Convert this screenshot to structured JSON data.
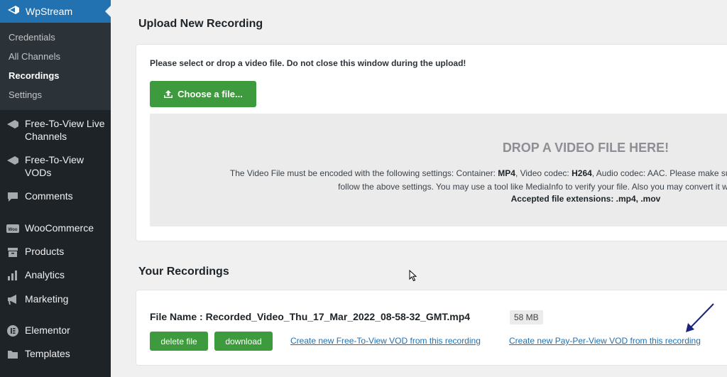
{
  "sidebar": {
    "app": "WpStream",
    "submenu": [
      "Credentials",
      "All Channels",
      "Recordings",
      "Settings"
    ],
    "active_sub": "Recordings",
    "items": [
      {
        "label": "Free-To-View Live Channels",
        "icon": "video-icon"
      },
      {
        "label": "Free-To-View VODs",
        "icon": "video-icon"
      },
      {
        "label": "Comments",
        "icon": "comment-icon"
      },
      {
        "label": "WooCommerce",
        "icon": "woo-icon"
      },
      {
        "label": "Products",
        "icon": "archive-icon"
      },
      {
        "label": "Analytics",
        "icon": "bar-chart-icon"
      },
      {
        "label": "Marketing",
        "icon": "megaphone-icon"
      },
      {
        "label": "Elementor",
        "icon": "elementor-icon"
      },
      {
        "label": "Templates",
        "icon": "folder-icon"
      }
    ]
  },
  "upload": {
    "heading": "Upload New Recording",
    "note": "Please select or drop a video file. Do not close this window during the upload!",
    "choose_label": "Choose a file...",
    "drop_title": "DROP A VIDEO FILE HERE!",
    "info1_pre": "The Video File must be encoded with the following settings: Container: ",
    "container": "MP4",
    "info1_mid": ", Video codec: ",
    "video_codec": "H264",
    "info1_post": ", Audio codec: AAC. Please make sure your video file follows these settings. Files that do not",
    "info2": "follow the above settings. You may use a tool like MediaInfo to verify your file. Also you may convert it with software like Handbrake.",
    "info3": "Accepted file extensions: .mp4, .mov"
  },
  "recordings": {
    "heading": "Your Recordings",
    "file_label": "File Name : Recorded_Video_Thu_17_Mar_2022_08-58-32_GMT.mp4",
    "size": "58 MB",
    "delete_label": "delete file",
    "download_label": "download",
    "link_free": "Create new Free-To-View VOD from this recording",
    "link_ppv": "Create new Pay-Per-View VOD from this recording"
  },
  "colors": {
    "sidebar_bg": "#1d2327",
    "accent": "#2271b1",
    "green": "#3d9b3d"
  }
}
